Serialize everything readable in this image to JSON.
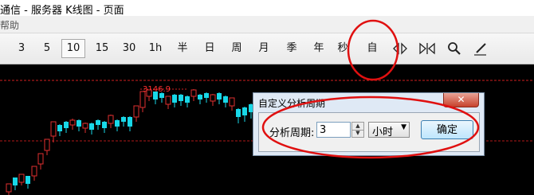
{
  "titlebar": {
    "text": "通信 - 服务器   K线图 - 页面"
  },
  "menubar": {
    "help": "帮助"
  },
  "toolbar": {
    "items": [
      "3",
      "5",
      "10",
      "15",
      "30",
      "1h",
      "半",
      "日",
      "周",
      "月",
      "季",
      "年",
      "秒",
      "自"
    ],
    "selected": "10",
    "icons": [
      "step-left-right-icon",
      "fit-bars-icon",
      "search-icon",
      "pen-icon"
    ]
  },
  "chart": {
    "price_label": "3146.9",
    "guide_color": "#d02020",
    "up_color": "#e03030",
    "down_color": "#18d8e8"
  },
  "dialog": {
    "title": "自定义分析周期",
    "close": "✕",
    "period_label": "分析周期:",
    "period_value": "3",
    "unit": "小时",
    "ok": "确定"
  },
  "annotations": {
    "color": "#e01010"
  }
}
